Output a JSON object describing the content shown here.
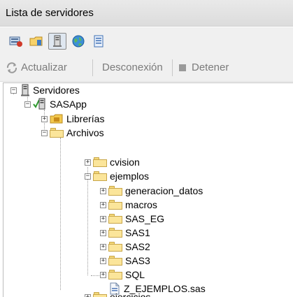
{
  "panel": {
    "title": "Lista de servidores"
  },
  "toolbar": {
    "icons": [
      "server-connect-icon",
      "folder-icon",
      "server-icon",
      "globe-icon",
      "list-icon"
    ]
  },
  "actions": {
    "refresh_label": "Actualizar",
    "disconnect_label": "Desconexión",
    "stop_label": "Detener"
  },
  "tree": {
    "servers": "Servidores",
    "sasapp": "SASApp",
    "libraries": "Librerías",
    "files": "Archivos",
    "cvision": "cvision",
    "ejemplos": "ejemplos",
    "generacion_datos": "generacion_datos",
    "macros": "macros",
    "sas_eg": "SAS_EG",
    "sas1": "SAS1",
    "sas2": "SAS2",
    "sas3": "SAS3",
    "sql": "SQL",
    "z_ejemplos": "Z_EJEMPLOS.sas",
    "ejercicios": "ejercicios"
  }
}
